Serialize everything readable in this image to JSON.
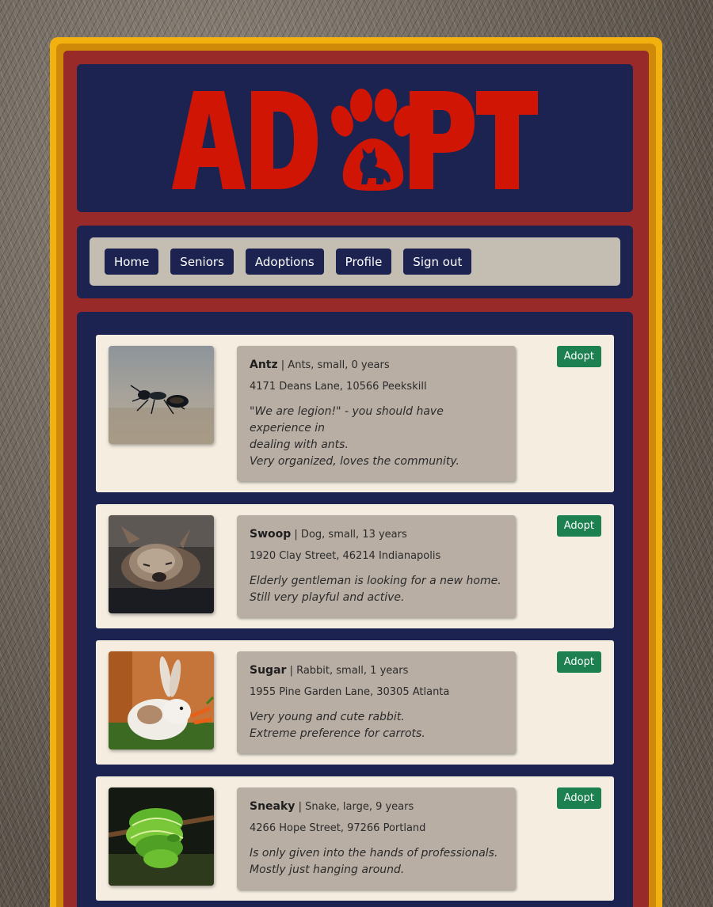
{
  "header": {
    "logo_text": "ADOPT"
  },
  "nav": {
    "items": [
      {
        "label": "Home"
      },
      {
        "label": "Seniors"
      },
      {
        "label": "Adoptions"
      },
      {
        "label": "Profile"
      },
      {
        "label": "Sign out"
      }
    ]
  },
  "pets": [
    {
      "name": "Antz",
      "details": "| Ants, small, 0 years",
      "address": "4171 Deans Lane, 10566 Peekskill",
      "desc_lines": [
        "\"We are legion!\" - you should have experience in",
        "dealing with ants.",
        "Very organized, loves the community."
      ],
      "adopt_label": "Adopt",
      "photo_icon": "ant-photo"
    },
    {
      "name": "Swoop",
      "details": "| Dog, small, 13 years",
      "address": "1920 Clay Street, 46214 Indianapolis",
      "desc_lines": [
        "Elderly gentleman is looking for a new home.",
        "Still very playful and active."
      ],
      "adopt_label": "Adopt",
      "photo_icon": "dog-photo"
    },
    {
      "name": "Sugar",
      "details": "| Rabbit, small, 1 years",
      "address": "1955 Pine Garden Lane, 30305 Atlanta",
      "desc_lines": [
        "Very young and cute rabbit.",
        "Extreme preference for carrots."
      ],
      "adopt_label": "Adopt",
      "photo_icon": "rabbit-photo"
    },
    {
      "name": "Sneaky",
      "details": "| Snake, large, 9 years",
      "address": "4266 Hope Street, 97266 Portland",
      "desc_lines": [
        "Is only given into the hands of professionals.",
        "Mostly just hanging around."
      ],
      "adopt_label": "Adopt",
      "photo_icon": "snake-photo"
    }
  ],
  "colors": {
    "navy": "#1c2350",
    "frame_red": "#982a2a",
    "frame_gold": "#f3b10f",
    "logo_red": "#d11505",
    "adopt_green": "#1c8050",
    "card_bg": "#f4ede0",
    "info_bg": "#b8aea4"
  }
}
